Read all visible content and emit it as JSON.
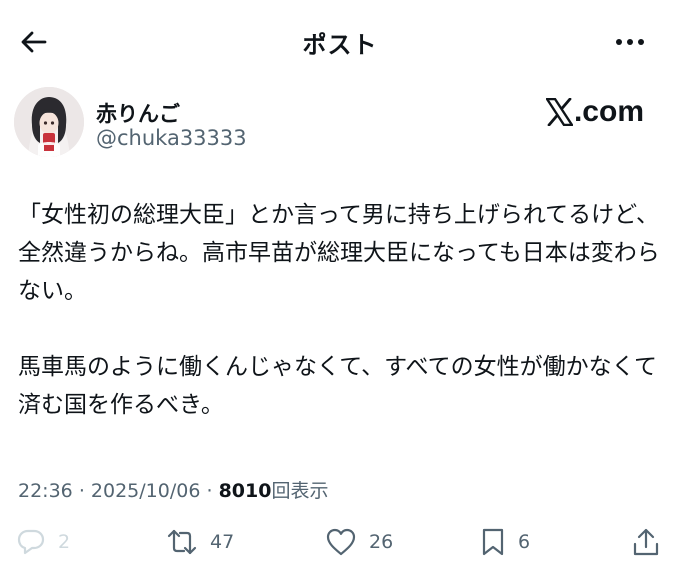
{
  "header": {
    "title": "ポスト",
    "back_icon": "arrow-left-icon",
    "more_icon": "more-horizontal-icon"
  },
  "author": {
    "display_name": "赤りんご",
    "handle": "@chuka33333",
    "avatar": "avatar"
  },
  "watermark": {
    "text": ".com",
    "logo_icon": "x-logo-icon"
  },
  "post": {
    "paragraphs": [
      "「女性初の総理大臣」とか言って男に持ち上げられてるけど、全然違うからね。高市早苗が総理大臣になっても日本は変わらない。",
      "馬車馬のように働くんじゃなくて、すべての女性が働かなくて済む国を作るべき。"
    ]
  },
  "meta": {
    "time": "22:36",
    "separator": "·",
    "date": "2025/10/06",
    "views": "8010",
    "views_label": "回表示"
  },
  "actions": {
    "reply_count": "2",
    "repost_count": "47",
    "like_count": "26",
    "bookmark_count": "6"
  },
  "colors": {
    "text": "#0f1419",
    "secondary": "#536471",
    "muted": "#cfd9de"
  }
}
